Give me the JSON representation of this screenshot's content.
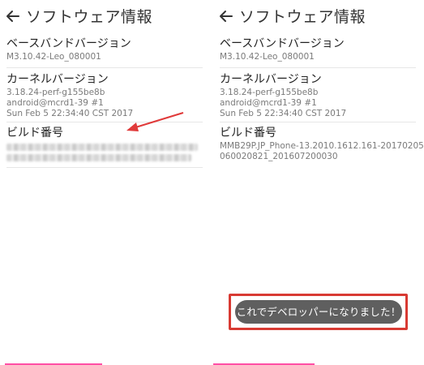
{
  "left_screen": {
    "title": "ソフトウェア情報",
    "baseband": {
      "label": "ベースバンドバージョン",
      "value": "M3.10.42-Leo_080001"
    },
    "kernel": {
      "label": "カーネルバージョン",
      "lines": [
        "3.18.24-perf-g155be8b",
        "android@mcrd1-39 #1",
        "Sun Feb 5 22:34:40 CST 2017"
      ]
    },
    "build": {
      "label": "ビルド番号"
    }
  },
  "right_screen": {
    "title": "ソフトウェア情報",
    "baseband": {
      "label": "ベースバンドバージョン",
      "value": "M3.10.42-Leo_080001"
    },
    "kernel": {
      "label": "カーネルバージョン",
      "lines": [
        "3.18.24-perf-g155be8b",
        "android@mcrd1-39 #1",
        "Sun Feb 5 22:34:40 CST 2017"
      ]
    },
    "build": {
      "label": "ビルド番号",
      "lines": [
        "MMB29P.JP_Phone-13.2010.1612.161-20170205",
        "060020821_201607200030"
      ]
    },
    "toast": "これでデベロッパーになりました！"
  },
  "icons": {
    "back": "arrow-left-icon",
    "pointer": "red-arrow-icon"
  },
  "colors": {
    "highlight_border": "#d83a33",
    "annotation_arrow": "#e03a3a",
    "toast_bg": "#5f5f5f",
    "accent_bar": "#ff4fa6"
  }
}
